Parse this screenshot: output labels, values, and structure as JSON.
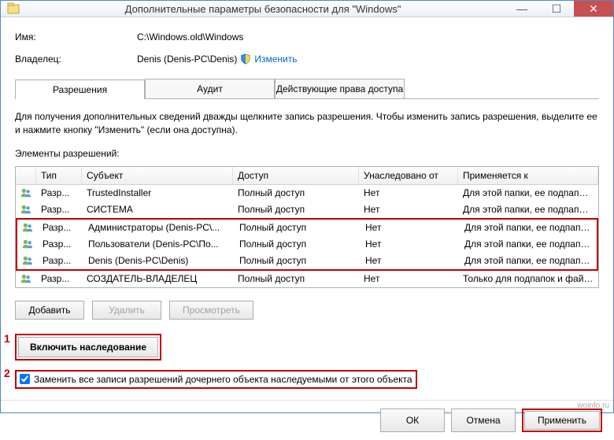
{
  "window": {
    "title": "Дополнительные параметры безопасности  для \"Windows\""
  },
  "fields": {
    "name_label": "Имя:",
    "name_value": "C:\\Windows.old\\Windows",
    "owner_label": "Владелец:",
    "owner_value": "Denis (Denis-PC\\Denis)",
    "change_link": "Изменить"
  },
  "tabs": {
    "perm": "Разрешения",
    "audit": "Аудит",
    "effective": "Действующие права доступа"
  },
  "description": "Для получения дополнительных сведений дважды щелкните запись разрешения. Чтобы изменить запись разрешения, выделите ее и нажмите кнопку \"Изменить\" (если она доступна).",
  "section_label": "Элементы разрешений:",
  "headers": {
    "type": "Тип",
    "subject": "Субъект",
    "access": "Доступ",
    "inherited": "Унаследовано от",
    "applies": "Применяется к"
  },
  "rows": [
    {
      "type": "Разр...",
      "subject": "TrustedInstaller",
      "access": "Полный доступ",
      "inherited": "Нет",
      "applies": "Для этой папки, ее подпапок ..."
    },
    {
      "type": "Разр...",
      "subject": "СИСТЕМА",
      "access": "Полный доступ",
      "inherited": "Нет",
      "applies": "Для этой папки, ее подпапок ..."
    },
    {
      "type": "Разр...",
      "subject": "Администраторы (Denis-PC\\...",
      "access": "Полный доступ",
      "inherited": "Нет",
      "applies": "Для этой папки, ее подпапок ..."
    },
    {
      "type": "Разр...",
      "subject": "Пользователи (Denis-PC\\По...",
      "access": "Полный доступ",
      "inherited": "Нет",
      "applies": "Для этой папки, ее подпапок ..."
    },
    {
      "type": "Разр...",
      "subject": "Denis (Denis-PC\\Denis)",
      "access": "Полный доступ",
      "inherited": "Нет",
      "applies": "Для этой папки, ее подпапок ..."
    },
    {
      "type": "Разр...",
      "subject": "СОЗДАТЕЛЬ-ВЛАДЕЛЕЦ",
      "access": "Полный доступ",
      "inherited": "Нет",
      "applies": "Только для подпапок и файл..."
    }
  ],
  "buttons": {
    "add": "Добавить",
    "remove": "Удалить",
    "view": "Просмотреть",
    "enable_inherit": "Включить наследование",
    "ok": "ОК",
    "cancel": "Отмена",
    "apply": "Применить"
  },
  "checkbox": {
    "replace_label": "Заменить все записи разрешений дочернего объекта наследуемыми от этого объекта"
  },
  "annotations": {
    "n1": "1",
    "n2": "2"
  },
  "watermark": "woinfo.ru"
}
